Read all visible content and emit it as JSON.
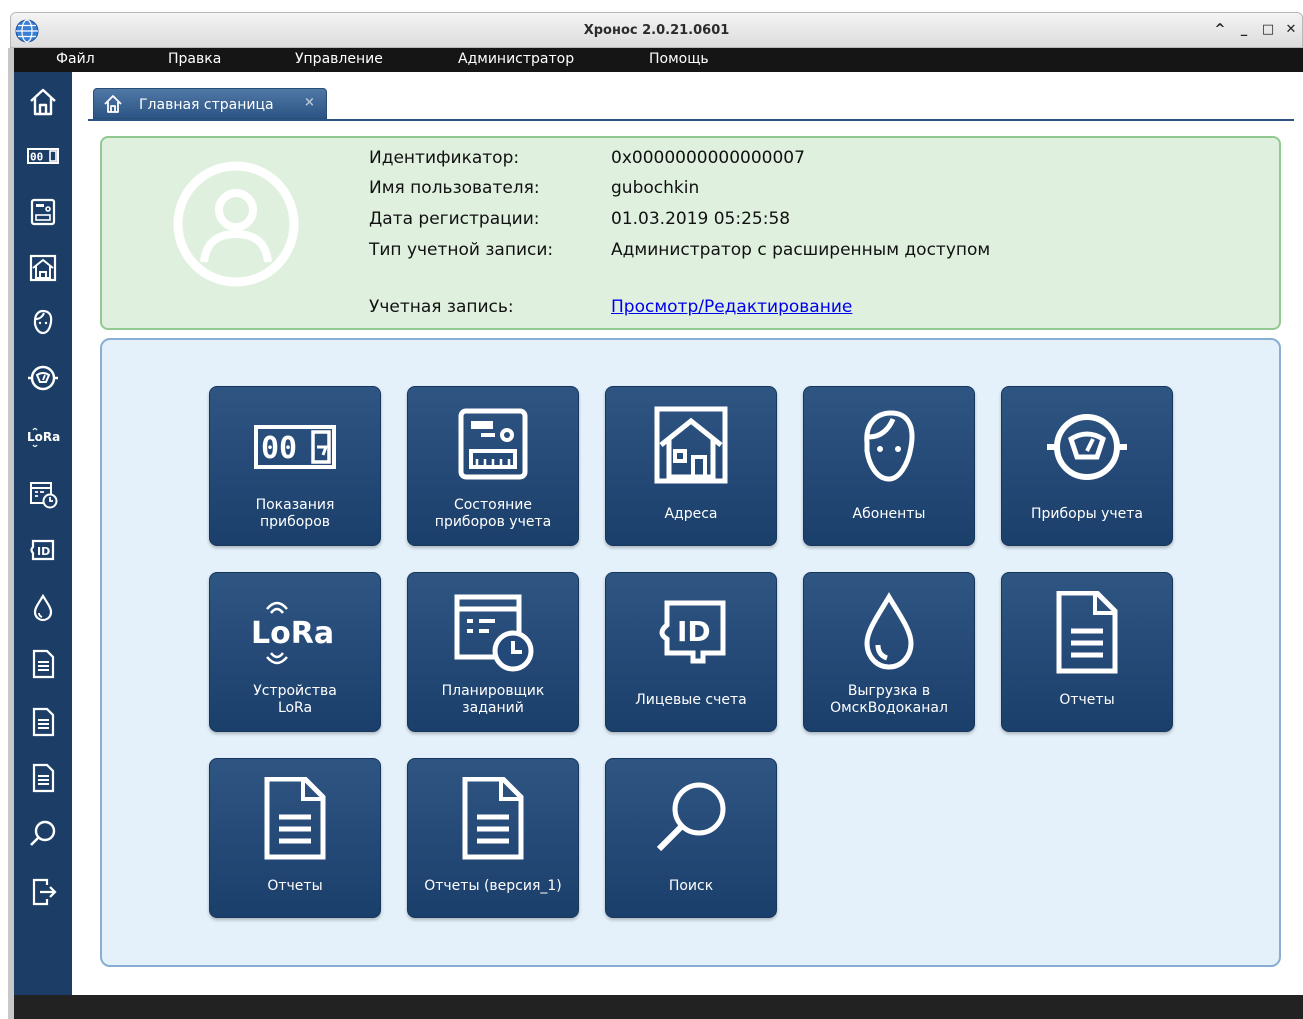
{
  "window": {
    "title": "Хронос 2.0.21.0601",
    "controls": [
      "^",
      "_",
      "□",
      "✕"
    ]
  },
  "menu": [
    "Файл",
    "Правка",
    "Управление",
    "Администратор",
    "Помощь"
  ],
  "sidebar": {
    "items": [
      {
        "icon": "home-icon"
      },
      {
        "icon": "counter-icon"
      },
      {
        "icon": "meter-status-icon"
      },
      {
        "icon": "address-icon"
      },
      {
        "icon": "subscriber-icon"
      },
      {
        "icon": "gauge-icon"
      },
      {
        "icon": "lora-icon",
        "text": "LoRa"
      },
      {
        "icon": "scheduler-icon"
      },
      {
        "icon": "id-icon",
        "text": "ID"
      },
      {
        "icon": "water-drop-icon"
      },
      {
        "icon": "document-icon"
      },
      {
        "icon": "document-icon"
      },
      {
        "icon": "document-icon"
      },
      {
        "icon": "search-icon"
      },
      {
        "icon": "logout-icon"
      }
    ]
  },
  "tab": {
    "label": "Главная страница",
    "close": "×"
  },
  "user": {
    "rows": [
      {
        "label": "Идентификатор:",
        "value": "0x0000000000000007"
      },
      {
        "label": "Имя пользователя:",
        "value": "gubochkin"
      },
      {
        "label": "Дата регистрации:",
        "value": "01.03.2019 05:25:58"
      },
      {
        "label": "Тип учетной записи:",
        "value": "Администратор с расширенным доступом"
      }
    ],
    "account_label": "Учетная запись:",
    "account_link": "Просмотр/Редактирование"
  },
  "tiles": [
    {
      "label": "Показания\nприборов",
      "icon": "counter-icon",
      "digits": "00"
    },
    {
      "label": "Состояние\nприборов учета",
      "icon": "meter-status-icon"
    },
    {
      "label": "Адреса",
      "icon": "address-icon"
    },
    {
      "label": "Абоненты",
      "icon": "subscriber-icon"
    },
    {
      "label": "Приборы учета",
      "icon": "gauge-icon"
    },
    {
      "label": "Устройства\nLoRa",
      "icon": "lora-icon",
      "text": "LoRa"
    },
    {
      "label": "Планировщик\nзаданий",
      "icon": "scheduler-icon"
    },
    {
      "label": "Лицевые счета",
      "icon": "id-icon",
      "text": "ID"
    },
    {
      "label": "Выгрузка в\nОмскВодоканал",
      "icon": "water-drop-icon"
    },
    {
      "label": "Отчеты",
      "icon": "document-icon"
    },
    {
      "label": "Отчеты",
      "icon": "document-icon"
    },
    {
      "label": "Отчеты (версия_1)",
      "icon": "document-icon"
    },
    {
      "label": "Поиск",
      "icon": "search-icon"
    }
  ],
  "colors": {
    "sidebar": "#1c3e66",
    "tile": "#1f4470",
    "user_card_bg": "#dff0df",
    "panel_bg": "#e4f1fb",
    "link": "#0000ee"
  }
}
